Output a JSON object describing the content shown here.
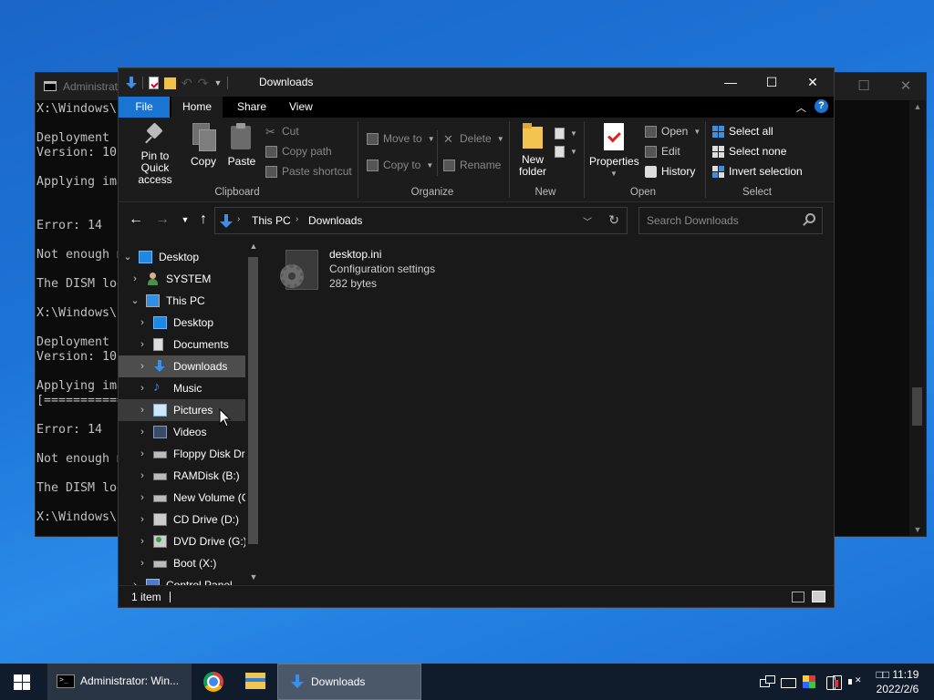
{
  "console": {
    "title": "Administrat",
    "lines": [
      "X:\\Windows\\S",
      "",
      "Deployment I",
      "Version: 10",
      "",
      "Applying ima",
      "",
      "",
      "Error: 14",
      "",
      "Not enough m",
      "",
      "The DISM log",
      "",
      "X:\\Windows\\S",
      "",
      "Deployment I",
      "Version: 10",
      "",
      "Applying ima",
      "[===========",
      "",
      "Error: 14",
      "",
      "Not enough m",
      "",
      "The DISM log",
      "",
      "X:\\Windows\\S"
    ],
    "minimize": "—",
    "maximize": "☐",
    "close": "✕"
  },
  "explorer": {
    "title": "Downloads",
    "window_controls": {
      "minimize": "—",
      "maximize": "☐",
      "close": "✕"
    },
    "tabs": {
      "file": "File",
      "home": "Home",
      "share": "Share",
      "view": "View"
    },
    "ribbon": {
      "clipboard": {
        "label": "Clipboard",
        "pin": "Pin to Quick access",
        "copy": "Copy",
        "paste": "Paste",
        "cut": "Cut",
        "copy_path": "Copy path",
        "paste_shortcut": "Paste shortcut"
      },
      "organize": {
        "label": "Organize",
        "move_to": "Move to",
        "copy_to": "Copy to",
        "delete": "Delete",
        "rename": "Rename"
      },
      "new": {
        "label": "New",
        "new_folder": "New folder"
      },
      "open": {
        "label": "Open",
        "properties": "Properties",
        "open": "Open",
        "edit": "Edit",
        "history": "History"
      },
      "select": {
        "label": "Select",
        "select_all": "Select all",
        "select_none": "Select none",
        "invert_selection": "Invert selection"
      }
    },
    "address": {
      "crumbs": [
        "This PC",
        "Downloads"
      ],
      "search_placeholder": "Search Downloads"
    },
    "nav_tree": [
      {
        "label": "Desktop"
      },
      {
        "label": "SYSTEM"
      },
      {
        "label": "This PC"
      },
      {
        "label": "Desktop"
      },
      {
        "label": "Documents"
      },
      {
        "label": "Downloads"
      },
      {
        "label": "Music"
      },
      {
        "label": "Pictures"
      },
      {
        "label": "Videos"
      },
      {
        "label": "Floppy Disk Dri"
      },
      {
        "label": "RAMDisk (B:)"
      },
      {
        "label": "New Volume (C"
      },
      {
        "label": "CD Drive (D:)"
      },
      {
        "label": "DVD Drive (G:)"
      },
      {
        "label": "Boot (X:)"
      },
      {
        "label": "Control Panel"
      }
    ],
    "files": [
      {
        "name": "desktop.ini",
        "type": "Configuration settings",
        "size": "282 bytes"
      }
    ],
    "status": {
      "count": "1 item"
    }
  },
  "taskbar": {
    "tasks": [
      {
        "label": "Administrator: Win..."
      },
      {
        "label": "Downloads"
      }
    ],
    "clock": {
      "time": "□□ 11:19",
      "date": "2022/2/6"
    }
  },
  "colors": {
    "accent": "#1a75d2",
    "window_bg": "#191919",
    "desktop": "#1d74d6"
  }
}
